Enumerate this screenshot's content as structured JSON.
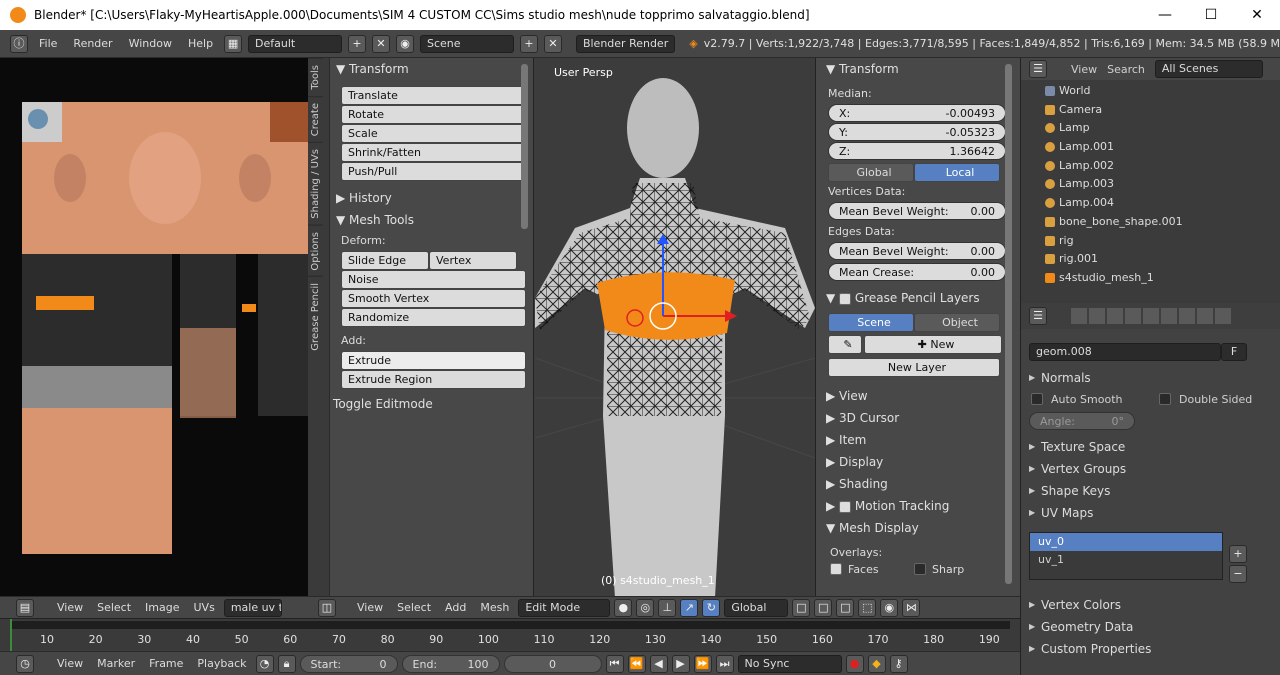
{
  "window": {
    "title": "Blender* [C:\\Users\\Flaky-MyHeartisApple.000\\Documents\\SIM 4 CUSTOM CC\\Sims studio mesh\\nude topprimo salvataggio.blend]"
  },
  "topbar": {
    "menus": [
      "File",
      "Render",
      "Window",
      "Help"
    ],
    "layout": "Default",
    "scene": "Scene",
    "engine": "Blender Render",
    "stats": "v2.79.7 | Verts:1,922/3,748 | Edges:3,771/8,595 | Faces:1,849/4,852 | Tris:6,169 | Mem: 34.5 MB (58.9 M"
  },
  "tabs": [
    "Tools",
    "Create",
    "Shading / UVs",
    "Options",
    "Grease Pencil"
  ],
  "tools": {
    "transform": "Transform",
    "buttons": [
      "Translate",
      "Rotate",
      "Scale",
      "Shrink/Fatten",
      "Push/Pull"
    ],
    "history": "History",
    "mesh_tools": "Mesh Tools",
    "deform": "Deform:",
    "slide_edge": "Slide Edge",
    "vertex": "Vertex",
    "deform_btns": [
      "Noise",
      "Smooth Vertex",
      "Randomize"
    ],
    "add": "Add:",
    "extrude": "Extrude",
    "extrude_region": "Extrude Region",
    "toggle": "Toggle Editmode"
  },
  "viewport": {
    "label": "User Persp",
    "object": "(0) s4studio_mesh_1"
  },
  "props": {
    "transform": "Transform",
    "median": "Median:",
    "x_label": "X:",
    "x": "-0.00493",
    "y_label": "Y:",
    "y": "-0.05323",
    "z_label": "Z:",
    "z": "1.36642",
    "global": "Global",
    "local": "Local",
    "vdata": "Vertices Data:",
    "mbw": "Mean Bevel Weight:",
    "mbw_v": "0.00",
    "edata": "Edges Data:",
    "mbw2": "Mean Bevel Weight:",
    "mbw2_v": "0.00",
    "mc": "Mean Crease:",
    "mc_v": "0.00",
    "gpl": "Grease Pencil Layers",
    "scene": "Scene",
    "object": "Object",
    "new": "New",
    "new_layer": "New Layer",
    "sections": [
      "View",
      "3D Cursor",
      "Item",
      "Display",
      "Shading"
    ],
    "motion": "Motion Tracking",
    "mesh_display": "Mesh Display",
    "overlays": "Overlays:",
    "faces": "Faces",
    "sharp": "Sharp"
  },
  "outliner": {
    "view": "View",
    "search": "Search",
    "scenes": "All Scenes",
    "items": [
      "World",
      "Camera",
      "Lamp",
      "Lamp.001",
      "Lamp.002",
      "Lamp.003",
      "Lamp.004",
      "bone_bone_shape.001",
      "rig",
      "rig.001",
      "s4studio_mesh_1"
    ]
  },
  "data": {
    "mesh_name": "geom.008",
    "f": "F",
    "normals": "Normals",
    "auto_smooth": "Auto Smooth",
    "double_sided": "Double Sided",
    "angle": "Angle:",
    "angle_v": "0°",
    "sections": [
      "Texture Space",
      "Vertex Groups",
      "Shape Keys"
    ],
    "uv_maps": "UV Maps",
    "uv": [
      "uv_0",
      "uv_1"
    ],
    "sections2": [
      "Vertex Colors",
      "Geometry Data",
      "Custom Properties"
    ]
  },
  "uvbar": {
    "menus": [
      "View",
      "Select",
      "Image",
      "UVs"
    ],
    "image": "male uv te"
  },
  "vpbar": {
    "menus": [
      "View",
      "Select",
      "Add",
      "Mesh"
    ],
    "mode": "Edit Mode",
    "orient": "Global"
  },
  "timeline": {
    "ticks": [
      "10",
      "20",
      "30",
      "40",
      "50",
      "60",
      "70",
      "80",
      "90",
      "100",
      "110",
      "120",
      "130",
      "140",
      "150",
      "160",
      "170",
      "180",
      "190"
    ],
    "menus": [
      "View",
      "Marker",
      "Frame",
      "Playback"
    ],
    "start_l": "Start:",
    "start": "0",
    "end_l": "End:",
    "end": "100",
    "current": "0",
    "sync": "No Sync"
  },
  "colors": {
    "accent": "#5680c2",
    "orange": "#f28a1a",
    "skin": "#d99570"
  }
}
